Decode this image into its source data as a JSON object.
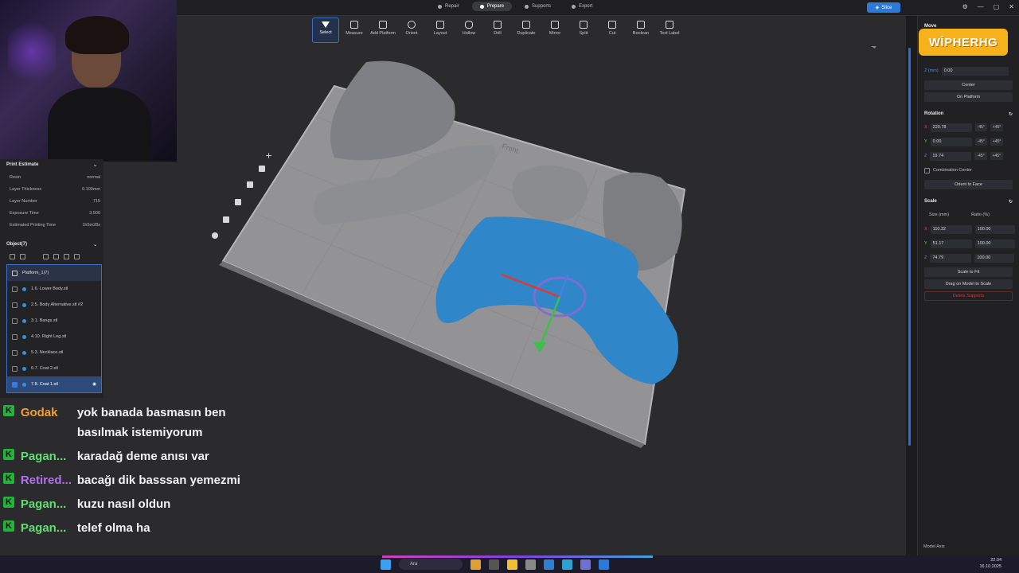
{
  "topbar": {
    "modes": [
      {
        "label": "Repair",
        "active": false
      },
      {
        "label": "Prepare",
        "active": true
      },
      {
        "label": "Supports",
        "active": false
      },
      {
        "label": "Export",
        "active": false
      }
    ],
    "slice_label": "Slice"
  },
  "toolbar": {
    "tools": [
      "Select",
      "Measure",
      "Add Platform",
      "Orient",
      "Layout",
      "Hollow",
      "Drill",
      "Duplicate",
      "Mirror",
      "Split",
      "Cut",
      "Boolean",
      "Text Label"
    ]
  },
  "print_estimate": {
    "title": "Print Estimate",
    "rows": [
      {
        "key": "Resin",
        "value": "normal"
      },
      {
        "key": "Layer Thickness",
        "value": "0.100mm"
      },
      {
        "key": "Layer Number",
        "value": "715"
      },
      {
        "key": "Exposure Time",
        "value": "3.500"
      },
      {
        "key": "Estimated Printing Time",
        "value": "1h5m28s"
      }
    ]
  },
  "objects": {
    "title": "Object(7)",
    "platform": "Platform_1(7)",
    "items": [
      {
        "label": "1.6. Lower Body.stl",
        "checked": false
      },
      {
        "label": "2.5. Body Alternative.stl #2",
        "checked": false
      },
      {
        "label": "3.1. Bangs.stl",
        "checked": false
      },
      {
        "label": "4.10. Right Leg.stl",
        "checked": false
      },
      {
        "label": "5.3. Necklace.stl",
        "checked": false
      },
      {
        "label": "6.7. Coat 2.stl",
        "checked": false
      },
      {
        "label": "7.8. Coat 1.stl",
        "checked": true
      }
    ]
  },
  "chat": {
    "messages": [
      {
        "user": "Godak",
        "color": "#f0a030",
        "text": "yok banada basmasın ben basılmak istemiyorum"
      },
      {
        "user": "Pagan...",
        "color": "#5fe070",
        "text": "karadağ deme anısı var"
      },
      {
        "user": "Retired...",
        "color": "#b070f0",
        "text": "bacağı dik basssan yemezmi"
      },
      {
        "user": "Pagan...",
        "color": "#5fe070",
        "text": "kuzu nasıl oldun"
      },
      {
        "user": "Pagan...",
        "color": "#5fe070",
        "text": "telef olma ha"
      }
    ]
  },
  "right_panel": {
    "logo": "WİPHERHG",
    "move_title": "Move",
    "move_z_unit": "Z (mm)",
    "move_z_value": "0.00",
    "center_label": "Center",
    "on_platform_label": "On Platform",
    "rotation_title": "Rotation",
    "rotation": [
      {
        "axis": "X",
        "value": "220.78"
      },
      {
        "axis": "Y",
        "value": "0.00"
      },
      {
        "axis": "Z",
        "value": "19.74"
      }
    ],
    "rot_minus": "-45°",
    "rot_plus": "+45°",
    "combination_center": "Combination Center",
    "orient_to_face": "Orient to Face",
    "scale_title": "Scale",
    "size_label": "Size (mm)",
    "ratio_label": "Ratio (%)",
    "scale": [
      {
        "axis": "X",
        "size": "110.32",
        "ratio": "100.00"
      },
      {
        "axis": "Y",
        "size": "51.17",
        "ratio": "100.00"
      },
      {
        "axis": "Z",
        "size": "74.79",
        "ratio": "100.00"
      }
    ],
    "scale_to_fit": "Scale to Fit",
    "drag_on_model": "Drag on Model to Scale",
    "delete_supports": "Delete Supports",
    "model_axis": "Model Axis"
  },
  "viewport": {
    "platform_label": "Front"
  },
  "taskbar": {
    "search_placeholder": "Ara",
    "time": "22:34",
    "date": "16.10.2025"
  },
  "colors": {
    "accent": "#2d7ad6",
    "model_blue": "#2f86c8",
    "model_gray": "#8a8c90",
    "platform": "#9a9a9c"
  }
}
